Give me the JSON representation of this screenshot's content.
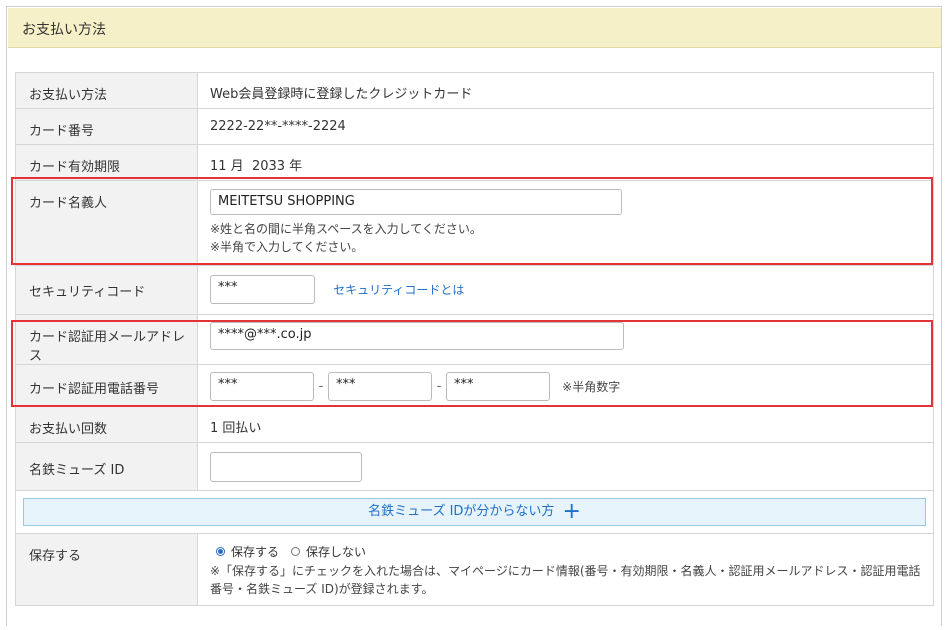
{
  "section": {
    "title": "お支払い方法"
  },
  "rows": {
    "method": {
      "label": "お支払い方法",
      "value": "Web会員登録時に登録したクレジットカード"
    },
    "card_number": {
      "label": "カード番号",
      "value": "2222-22**-****-2224"
    },
    "expiry": {
      "label": "カード有効期限",
      "value": "11 月  2033 年"
    },
    "holder": {
      "label": "カード名義人",
      "input_value": "MEITETSU SHOPPING",
      "note1": "※姓と名の間に半角スペースを入力してください。",
      "note2": "※半角で入力してください。"
    },
    "security": {
      "label": "セキュリティコード",
      "input_value": "***",
      "link": "セキュリティコードとは"
    },
    "email": {
      "label": "カード認証用メールアドレス",
      "input_value": "****@***.co.jp"
    },
    "phone": {
      "label": "カード認証用電話番号",
      "part1": "***",
      "part2": "***",
      "part3": "***",
      "dash": "-",
      "note": "※半角数字"
    },
    "installments": {
      "label": "お支払い回数",
      "value": "1 回払い"
    },
    "muse_id": {
      "label": "名鉄ミューズ ID",
      "input_value": ""
    },
    "muse_help": {
      "label": "名鉄ミューズ IDが分からない方",
      "icon": "plus-icon"
    },
    "save": {
      "label": "保存する",
      "option_yes": "保存する",
      "option_no": "保存しない",
      "selected": "保存する",
      "note": "※「保存する」にチェックを入れた場合は、マイページにカード情報(番号・有効期限・名義人・認証用メールアドレス・認証用電話番号・名鉄ミューズ ID)が登録されます。"
    }
  },
  "colors": {
    "highlight": "#e53238",
    "link": "#2070c8",
    "header_bg": "#f6f0c8",
    "label_bg": "#f2f2f2"
  }
}
